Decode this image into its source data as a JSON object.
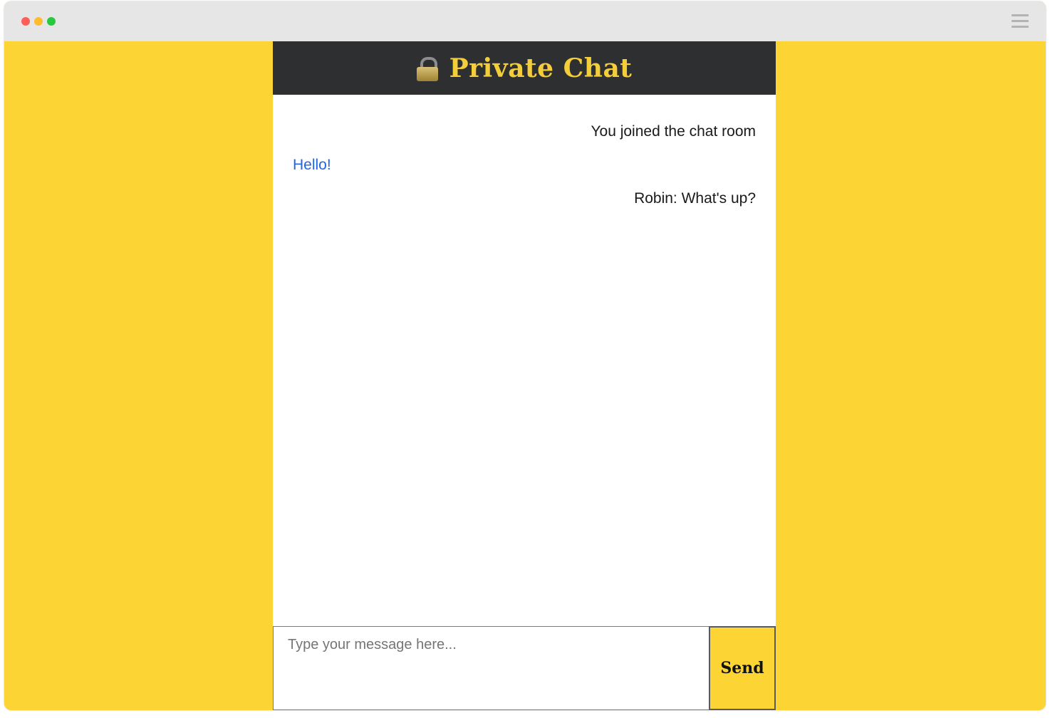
{
  "header": {
    "title": "Private Chat",
    "icon": "lock-icon"
  },
  "messages": [
    {
      "text": "You joined the chat room",
      "align": "right"
    },
    {
      "text": "Hello!",
      "align": "left"
    },
    {
      "text": "Robin: What's up?",
      "align": "right"
    }
  ],
  "composer": {
    "placeholder": "Type your message here...",
    "value": "",
    "send_label": "Send"
  },
  "colors": {
    "page_background": "#fcd535",
    "header_background": "#2e2f31",
    "title_color": "#f4cd3a",
    "own_message_color": "#2166e6",
    "send_button": "#fcd535"
  }
}
